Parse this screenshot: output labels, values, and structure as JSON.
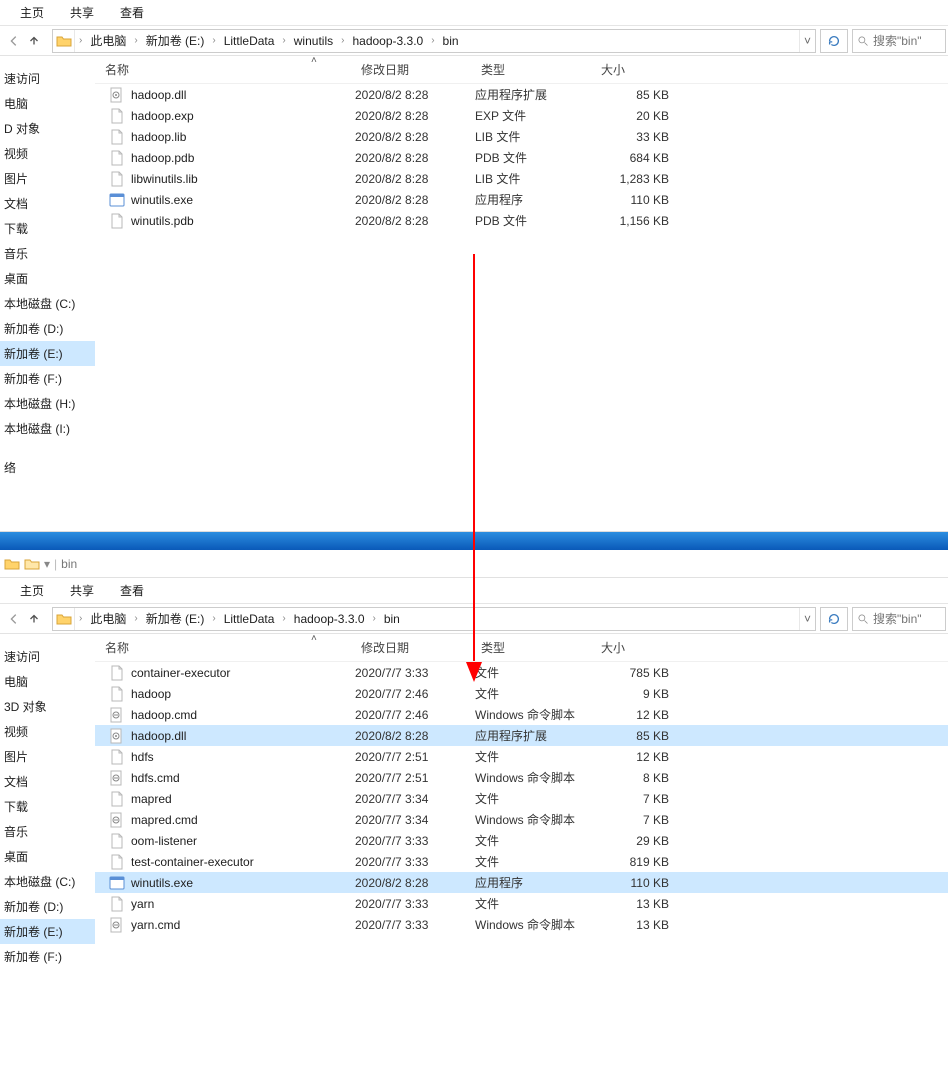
{
  "tabs": {
    "home": "主页",
    "share": "共享",
    "view": "查看"
  },
  "breadcrumb1": {
    "pc": "此电脑",
    "vol": "新加卷 (E:)",
    "p1": "LittleData",
    "p2": "winutils",
    "p3": "hadoop-3.3.0",
    "p4": "bin"
  },
  "breadcrumb2": {
    "pc": "此电脑",
    "vol": "新加卷 (E:)",
    "p1": "LittleData",
    "p2": "hadoop-3.3.0",
    "p3": "bin"
  },
  "search_placeholder": "搜索\"bin\"",
  "columns": {
    "name": "名称",
    "date": "修改日期",
    "type": "类型",
    "size": "大小"
  },
  "nav1": {
    "items": [
      "速访问",
      "电脑",
      "D 对象",
      "视频",
      "图片",
      "文档",
      "下载",
      "音乐",
      "桌面",
      "本地磁盘 (C:)",
      "新加卷 (D:)",
      "新加卷 (E:)",
      "新加卷 (F:)",
      "本地磁盘 (H:)",
      "本地磁盘 (I:)",
      "",
      "络"
    ],
    "selected_index": 11
  },
  "nav2": {
    "items": [
      "速访问",
      "电脑",
      "3D 对象",
      "视频",
      "图片",
      "文档",
      "下载",
      "音乐",
      "桌面",
      "本地磁盘 (C:)",
      "新加卷 (D:)",
      "新加卷 (E:)",
      "新加卷 (F:)"
    ],
    "selected_index": 11
  },
  "files1": [
    {
      "name": "hadoop.dll",
      "date": "2020/8/2 8:28",
      "type": "应用程序扩展",
      "size": "85 KB",
      "icon": "dll"
    },
    {
      "name": "hadoop.exp",
      "date": "2020/8/2 8:28",
      "type": "EXP 文件",
      "size": "20 KB",
      "icon": "file"
    },
    {
      "name": "hadoop.lib",
      "date": "2020/8/2 8:28",
      "type": "LIB 文件",
      "size": "33 KB",
      "icon": "file"
    },
    {
      "name": "hadoop.pdb",
      "date": "2020/8/2 8:28",
      "type": "PDB 文件",
      "size": "684 KB",
      "icon": "file"
    },
    {
      "name": "libwinutils.lib",
      "date": "2020/8/2 8:28",
      "type": "LIB 文件",
      "size": "1,283 KB",
      "icon": "file"
    },
    {
      "name": "winutils.exe",
      "date": "2020/8/2 8:28",
      "type": "应用程序",
      "size": "110 KB",
      "icon": "exe"
    },
    {
      "name": "winutils.pdb",
      "date": "2020/8/2 8:28",
      "type": "PDB 文件",
      "size": "1,156 KB",
      "icon": "file"
    }
  ],
  "files2": [
    {
      "name": "container-executor",
      "date": "2020/7/7 3:33",
      "type": "文件",
      "size": "785 KB",
      "icon": "file",
      "sel": false
    },
    {
      "name": "hadoop",
      "date": "2020/7/7 2:46",
      "type": "文件",
      "size": "9 KB",
      "icon": "file",
      "sel": false
    },
    {
      "name": "hadoop.cmd",
      "date": "2020/7/7 2:46",
      "type": "Windows 命令脚本",
      "size": "12 KB",
      "icon": "cmd",
      "sel": false
    },
    {
      "name": "hadoop.dll",
      "date": "2020/8/2 8:28",
      "type": "应用程序扩展",
      "size": "85 KB",
      "icon": "dll",
      "sel": true
    },
    {
      "name": "hdfs",
      "date": "2020/7/7 2:51",
      "type": "文件",
      "size": "12 KB",
      "icon": "file",
      "sel": false
    },
    {
      "name": "hdfs.cmd",
      "date": "2020/7/7 2:51",
      "type": "Windows 命令脚本",
      "size": "8 KB",
      "icon": "cmd",
      "sel": false
    },
    {
      "name": "mapred",
      "date": "2020/7/7 3:34",
      "type": "文件",
      "size": "7 KB",
      "icon": "file",
      "sel": false
    },
    {
      "name": "mapred.cmd",
      "date": "2020/7/7 3:34",
      "type": "Windows 命令脚本",
      "size": "7 KB",
      "icon": "cmd",
      "sel": false
    },
    {
      "name": "oom-listener",
      "date": "2020/7/7 3:33",
      "type": "文件",
      "size": "29 KB",
      "icon": "file",
      "sel": false
    },
    {
      "name": "test-container-executor",
      "date": "2020/7/7 3:33",
      "type": "文件",
      "size": "819 KB",
      "icon": "file",
      "sel": false
    },
    {
      "name": "winutils.exe",
      "date": "2020/8/2 8:28",
      "type": "应用程序",
      "size": "110 KB",
      "icon": "exe",
      "sel": true
    },
    {
      "name": "yarn",
      "date": "2020/7/7 3:33",
      "type": "文件",
      "size": "13 KB",
      "icon": "file",
      "sel": false
    },
    {
      "name": "yarn.cmd",
      "date": "2020/7/7 3:33",
      "type": "Windows 命令脚本",
      "size": "13 KB",
      "icon": "cmd",
      "sel": false
    }
  ],
  "window2_title": "bin"
}
